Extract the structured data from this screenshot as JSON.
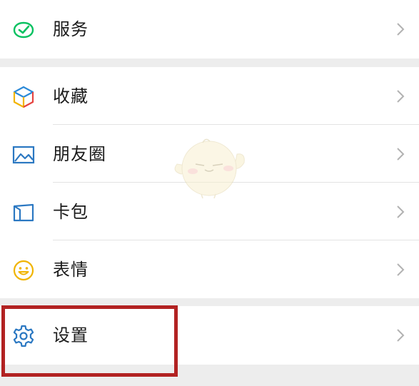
{
  "menu": {
    "service": {
      "label": "服务",
      "icon": "service-icon",
      "color": "#07c160"
    },
    "favorites": {
      "label": "收藏",
      "icon": "favorites-cube-icon"
    },
    "moments": {
      "label": "朋友圈",
      "icon": "moments-picture-icon",
      "color": "#2b78c2"
    },
    "cards": {
      "label": "卡包",
      "icon": "card-wallet-icon",
      "color": "#2b78c2"
    },
    "stickers": {
      "label": "表情",
      "icon": "sticker-smiley-icon",
      "color": "#f0b400"
    },
    "settings": {
      "label": "设置",
      "icon": "gear-icon",
      "color": "#2b78c2"
    }
  },
  "colors": {
    "highlight": "#b22222",
    "background": "#ededed"
  }
}
